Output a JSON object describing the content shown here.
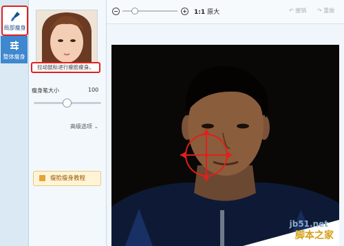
{
  "rail": {
    "local_label": "局部瘦身",
    "whole_label": "整体瘦身"
  },
  "panel": {
    "hint": "拉动鼠标进行瘦脸瘦身。",
    "brush_label": "瘦身笔大小",
    "brush_value": "100",
    "brush_level_fraction": 0.5,
    "advanced_label": "高级选项",
    "tutorial_label": "瘦脸瘦身教程"
  },
  "toolbar": {
    "ratio_bold": "1:1",
    "ratio_label": "原大",
    "undo_label": "撤销",
    "redo_label": "重做"
  },
  "watermark": {
    "line1": "jb51.net",
    "line2": "脚本之家"
  },
  "colors": {
    "highlight": "#e0201b",
    "accent": "#3f87cf",
    "photo_bg": "#0a0806"
  }
}
